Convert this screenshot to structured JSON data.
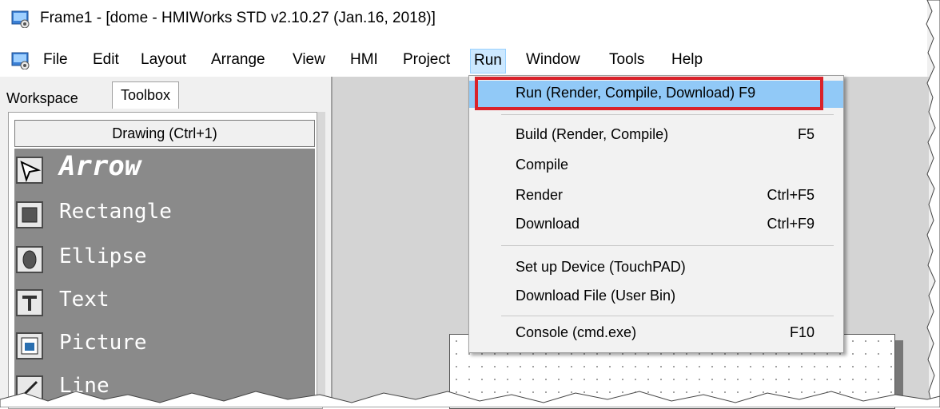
{
  "window": {
    "title": "Frame1 - [dome - HMIWorks STD v2.10.27 (Jan.16, 2018)]",
    "icon": "app-icon"
  },
  "menubar": {
    "items": [
      {
        "label": "File"
      },
      {
        "label": "Edit"
      },
      {
        "label": "Layout"
      },
      {
        "label": "Arrange"
      },
      {
        "label": "View"
      },
      {
        "label": "HMI"
      },
      {
        "label": "Project"
      },
      {
        "label": "Run",
        "active": true
      },
      {
        "label": "Window"
      },
      {
        "label": "Tools"
      },
      {
        "label": "Help"
      }
    ]
  },
  "tabs": {
    "workspace": "Workspace",
    "toolbox": "Toolbox"
  },
  "toolbox": {
    "header": "Drawing (Ctrl+1)",
    "tools": [
      {
        "label": "Arrow",
        "icon": "arrow-cursor-icon",
        "selected": true
      },
      {
        "label": "Rectangle",
        "icon": "rectangle-icon"
      },
      {
        "label": "Ellipse",
        "icon": "ellipse-icon"
      },
      {
        "label": "Text",
        "icon": "text-icon"
      },
      {
        "label": "Picture",
        "icon": "picture-icon"
      },
      {
        "label": "Line",
        "icon": "line-icon"
      }
    ]
  },
  "run_menu": {
    "items": [
      {
        "label": "Run (Render, Compile, Download) F9",
        "shortcut": "",
        "highlighted": true
      },
      {
        "label": "Build (Render, Compile)",
        "shortcut": "F5"
      },
      {
        "label": "Compile",
        "shortcut": ""
      },
      {
        "label": "Render",
        "shortcut": "Ctrl+F5"
      },
      {
        "label": "Download",
        "shortcut": "Ctrl+F9"
      },
      {
        "label": "Set up Device (TouchPAD)",
        "shortcut": ""
      },
      {
        "label": "Download File (User Bin)",
        "shortcut": ""
      },
      {
        "label": "Console (cmd.exe)",
        "shortcut": "F10"
      }
    ]
  },
  "colors": {
    "highlight": "#91c9f7",
    "annotation_box": "#d9222a",
    "toolbox_bg": "#8a8a8a"
  }
}
